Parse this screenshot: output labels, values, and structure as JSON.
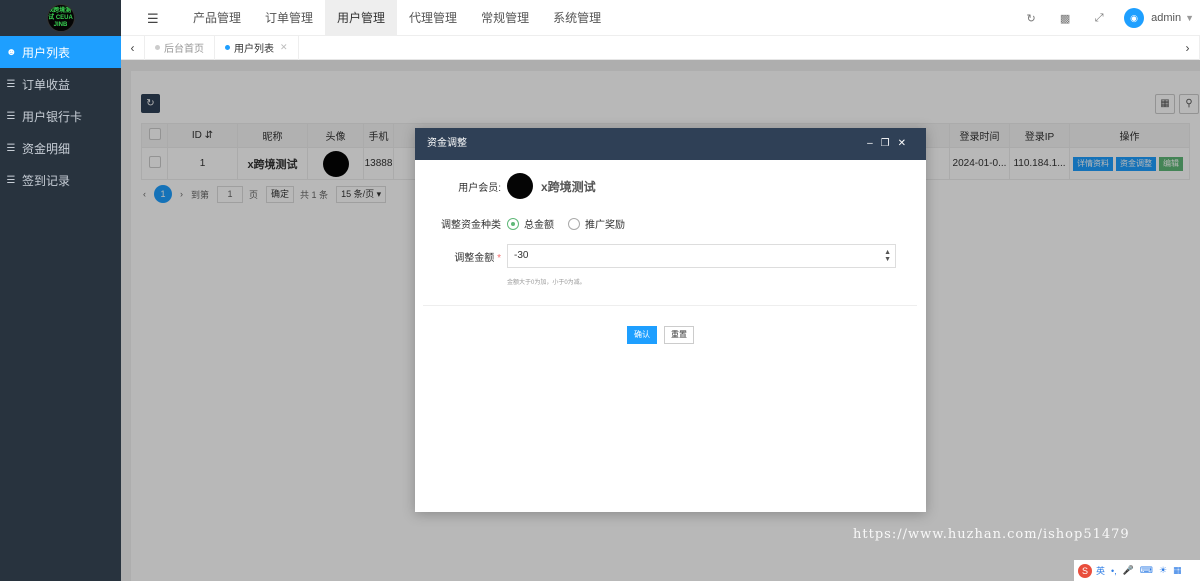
{
  "logo": {
    "text": "x跨境测试\nCEUA JINB"
  },
  "sidebar": {
    "items": [
      {
        "label": "用户列表",
        "icon": "users-icon",
        "active": true
      },
      {
        "label": "订单收益",
        "icon": "list-icon",
        "active": false
      },
      {
        "label": "用户银行卡",
        "icon": "list-icon",
        "active": false
      },
      {
        "label": "资金明细",
        "icon": "list-icon",
        "active": false
      },
      {
        "label": "签到记录",
        "icon": "list-icon",
        "active": false
      }
    ]
  },
  "topnav": {
    "items": [
      "产品管理",
      "订单管理",
      "用户管理",
      "代理管理",
      "常规管理",
      "系统管理"
    ],
    "active": "用户管理"
  },
  "user": {
    "name": "admin"
  },
  "tabs": {
    "items": [
      {
        "label": "后台首页"
      },
      {
        "label": "用户列表"
      }
    ]
  },
  "table": {
    "headers": [
      "ID",
      "昵称",
      "头像",
      "手机",
      "登录时间",
      "登录IP",
      "操作"
    ],
    "row": {
      "id": "1",
      "nickname": "x跨境测试",
      "phone": "13888",
      "login_time": "2024-01-0...",
      "login_ip": "110.184.1...",
      "actions": [
        "详情资料",
        "资金调整",
        "编辑"
      ]
    }
  },
  "pager": {
    "current": "1",
    "goto_label": "到第",
    "page_value": "1",
    "page_unit": "页",
    "confirm": "确定",
    "total": "共 1 条",
    "per_page": "15 条/页"
  },
  "modal": {
    "title": "资金调整",
    "member_label": "用户会员:",
    "member_name": "x跨境测试",
    "type_label": "调整资金种类",
    "type_options": [
      "总金额",
      "推广奖励"
    ],
    "type_selected": "总金额",
    "amount_label": "调整金额",
    "amount_value": "-30",
    "hint": "金额大于0为加，小于0为减。",
    "ok": "确认",
    "reset": "重置"
  },
  "watermark": "https://www.huzhan.com/ishop51479",
  "ime": {
    "label": "英"
  }
}
